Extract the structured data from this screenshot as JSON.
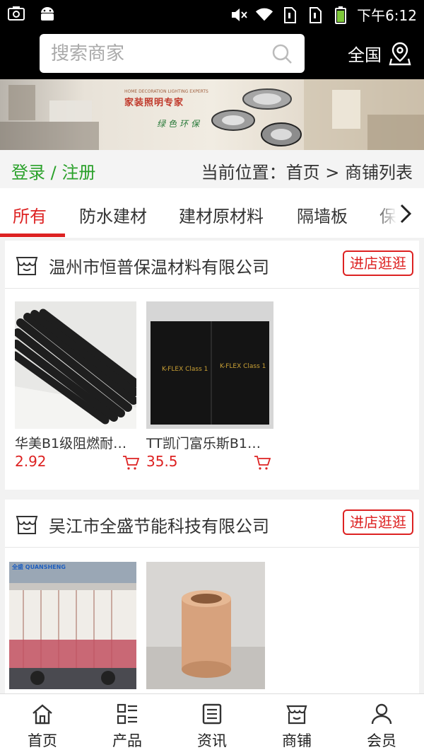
{
  "status_bar": {
    "time": "下午6:12"
  },
  "search": {
    "placeholder": "搜索商家",
    "region": "全国"
  },
  "banner": {
    "subtitle": "HOME DECORATION LIGHTING EXPERTS",
    "title": "家装照明专家",
    "slogan": "绿色环保"
  },
  "breadcrumb_bar": {
    "login": "登录 / 注册",
    "location": "当前位置：首页 > 商铺列表"
  },
  "tabs": [
    "所有",
    "防水建材",
    "建材原材料",
    "隔墙板",
    "保"
  ],
  "shops": [
    {
      "name": "温州市恒普保温材料有限公司",
      "visit_label": "进店逛逛",
      "products": [
        {
          "name": "华美B1级阻燃耐…",
          "price": "2.92"
        },
        {
          "name": "TT凯门富乐斯B1…",
          "price": "35.5"
        }
      ]
    },
    {
      "name": "吴江市全盛节能科技有限公司",
      "visit_label": "进店逛逛",
      "products": [
        {
          "name": "",
          "price": ""
        },
        {
          "name": "",
          "price": ""
        }
      ]
    }
  ],
  "product_images": {
    "box_label": "K-FLEX Class 1",
    "truck_label": "全盛 QUANSHENG"
  },
  "bottom_nav": [
    {
      "label": "首页",
      "icon": "home-icon"
    },
    {
      "label": "产品",
      "icon": "product-list-icon"
    },
    {
      "label": "资讯",
      "icon": "news-icon"
    },
    {
      "label": "商铺",
      "icon": "shop-icon"
    },
    {
      "label": "会员",
      "icon": "member-icon"
    }
  ],
  "colors": {
    "accent": "#dd2222",
    "login_green": "#2aa12a",
    "header_bg": "#000000"
  }
}
